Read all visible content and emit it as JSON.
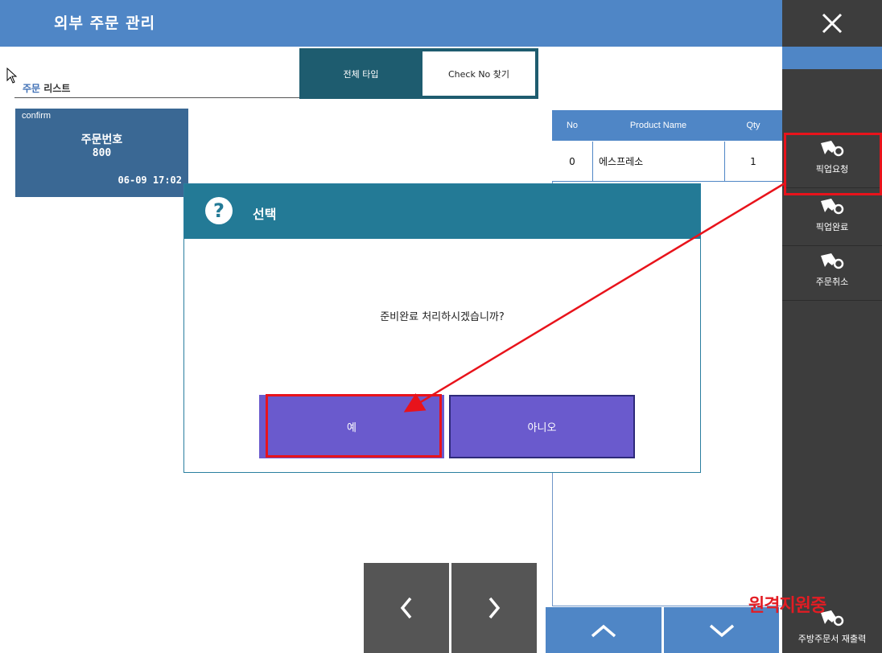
{
  "header": {
    "title": "외부 주문 관리"
  },
  "sidebar": {
    "close_icon": "close-icon",
    "items": [
      {
        "label": "픽업요청",
        "icon": "hand-gear-icon"
      },
      {
        "label": "픽업완료",
        "icon": "hand-gear-icon"
      },
      {
        "label": "주문취소",
        "icon": "hand-gear-icon"
      },
      {
        "label": "주방주문서 재출력",
        "icon": "hand-gear-icon"
      }
    ]
  },
  "order_list": {
    "title_accent": "주문",
    "title_rest": " 리스트",
    "filter_tabs": [
      {
        "label": "전체 타입"
      },
      {
        "label": "Check No 찾기"
      }
    ],
    "orders": [
      {
        "status": "confirm",
        "label": "주문번호",
        "number": "800",
        "time": "06-09 17:02"
      }
    ]
  },
  "product_table": {
    "columns": [
      "No",
      "Product Name",
      "Qty"
    ],
    "rows": [
      {
        "no": "0",
        "name": "에스프레소",
        "qty": "1"
      }
    ]
  },
  "dialog": {
    "icon": "question-icon",
    "title": "선택",
    "message": "준비완료 처리하시겠습니까?",
    "yes_label": "예",
    "no_label": "아니오"
  },
  "nav": {
    "prev_icon": "chevron-left-icon",
    "next_icon": "chevron-right-icon",
    "up_icon": "chevron-up-icon",
    "down_icon": "chevron-down-icon"
  },
  "watermark": "원격지원중",
  "colors": {
    "header_blue": "#4f86c6",
    "sidebar_dark": "#3d3d3d",
    "dialog_teal": "#237a96",
    "button_purple": "#6a5acd",
    "annotation_red": "#e8131b"
  }
}
